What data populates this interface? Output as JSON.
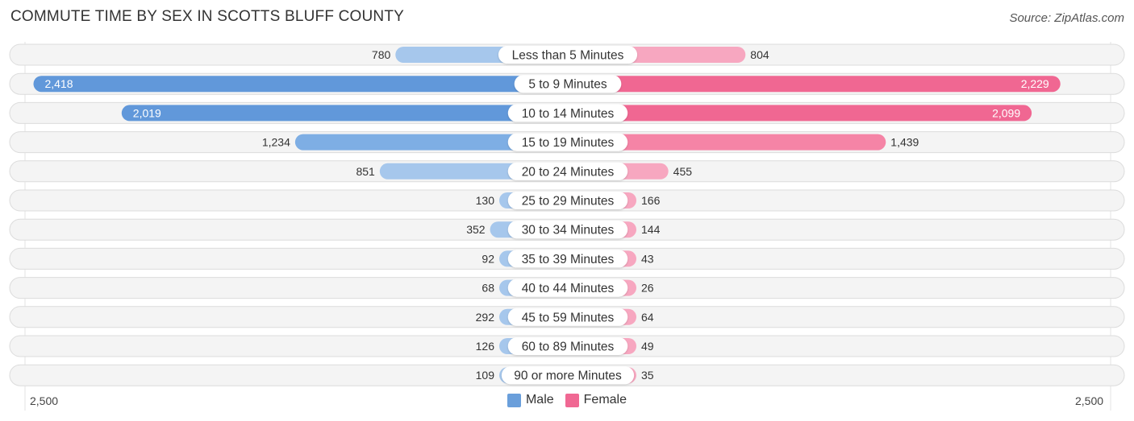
{
  "chart_data": {
    "type": "bar",
    "orientation": "horizontal-diverging",
    "title": "COMMUTE TIME BY SEX IN SCOTTS BLUFF COUNTY",
    "source": "Source: ZipAtlas.com",
    "categories": [
      "Less than 5 Minutes",
      "5 to 9 Minutes",
      "10 to 14 Minutes",
      "15 to 19 Minutes",
      "20 to 24 Minutes",
      "25 to 29 Minutes",
      "30 to 34 Minutes",
      "35 to 39 Minutes",
      "40 to 44 Minutes",
      "45 to 59 Minutes",
      "60 to 89 Minutes",
      "90 or more Minutes"
    ],
    "series": [
      {
        "name": "Male",
        "color": "#6a9fdb",
        "light_color": "#a9c8ec",
        "values": [
          780,
          2418,
          2019,
          1234,
          851,
          130,
          352,
          92,
          68,
          292,
          126,
          109
        ],
        "labels": [
          "780",
          "2,418",
          "2,019",
          "1,234",
          "851",
          "130",
          "352",
          "92",
          "68",
          "292",
          "126",
          "109"
        ]
      },
      {
        "name": "Female",
        "color": "#f06893",
        "light_color": "#f6a8c0",
        "values": [
          804,
          2229,
          2099,
          1439,
          455,
          166,
          144,
          43,
          26,
          64,
          49,
          35
        ],
        "labels": [
          "804",
          "2,229",
          "2,099",
          "1,439",
          "455",
          "166",
          "144",
          "43",
          "26",
          "64",
          "49",
          "35"
        ]
      }
    ],
    "axis": {
      "min_label": "2,500",
      "max_label": "2,500",
      "max": 2500
    },
    "legend": {
      "position": "bottom-center",
      "items": [
        "Male",
        "Female"
      ]
    },
    "grid": false
  }
}
